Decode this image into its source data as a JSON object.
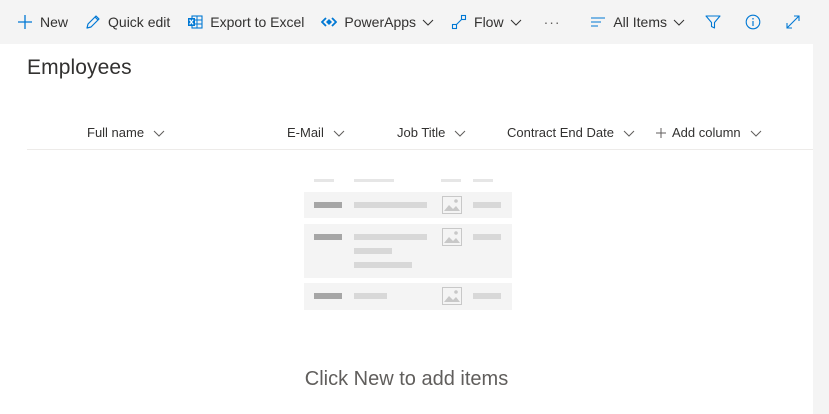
{
  "command_bar": {
    "new_label": "New",
    "quick_edit_label": "Quick edit",
    "export_label": "Export to Excel",
    "powerapps_label": "PowerApps",
    "flow_label": "Flow",
    "more_label": "···",
    "view_label": "All Items"
  },
  "list": {
    "title": "Employees",
    "columns": [
      "Full name",
      "E-Mail",
      "Job Title",
      "Contract End Date"
    ],
    "add_column_label": "Add column"
  },
  "empty_state": {
    "message": "Click New to add items"
  },
  "colors": {
    "accent": "#0078d4",
    "command_bar_bg": "#f4f4f4",
    "text": "#323130",
    "muted_text": "#605e5c"
  }
}
